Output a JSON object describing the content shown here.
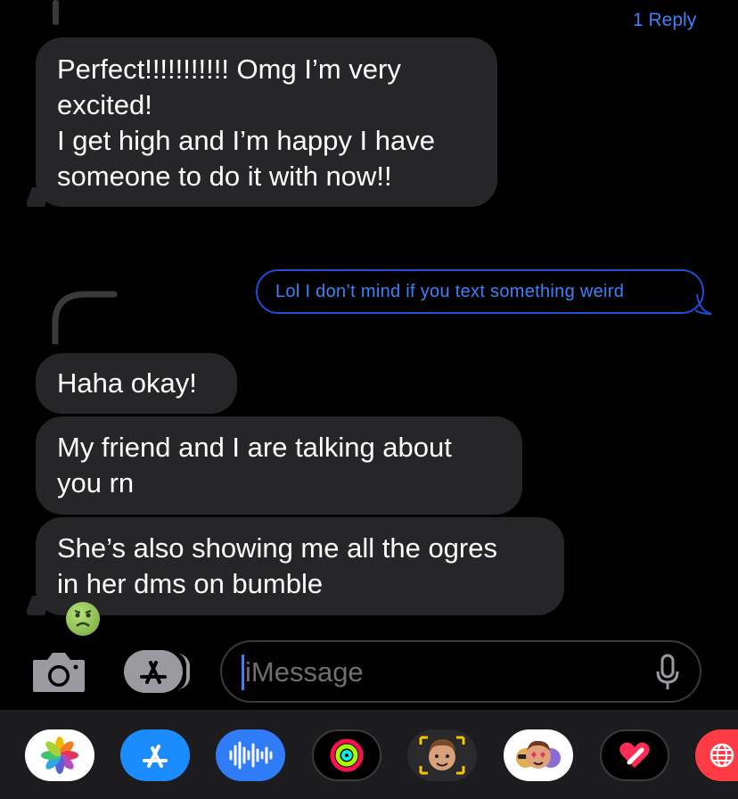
{
  "thread": {
    "reply_count": "1 Reply"
  },
  "messages": [
    {
      "lines": [
        "Perfect!!!!!!!!!!! Omg I’m very",
        "excited!",
        "I get high and I’m happy I have",
        "someone to do it with now!!"
      ]
    },
    {
      "reply_preview": "Lol I don’t mind if you text something weird"
    },
    {
      "lines": [
        "Haha okay!"
      ]
    },
    {
      "lines": [
        "My friend and I are talking about",
        "you rn"
      ]
    },
    {
      "lines": [
        "She’s also showing me all the ogres",
        "in her dms on bumble"
      ],
      "emoji": "nauseated-face"
    }
  ],
  "composer": {
    "placeholder": "iMessage",
    "camera_icon": "camera-icon",
    "apps_icon": "app-store-icon",
    "mic_icon": "microphone-icon"
  },
  "app_drawer": {
    "apps": [
      "photos",
      "app-store",
      "audio-message",
      "activity",
      "memoji",
      "memoji-stickers",
      "digital-touch",
      "web-search"
    ]
  },
  "colors": {
    "background": "#000000",
    "bubble": "#262628",
    "accent": "#3b82f6",
    "drawer": "#1c1c1e"
  }
}
